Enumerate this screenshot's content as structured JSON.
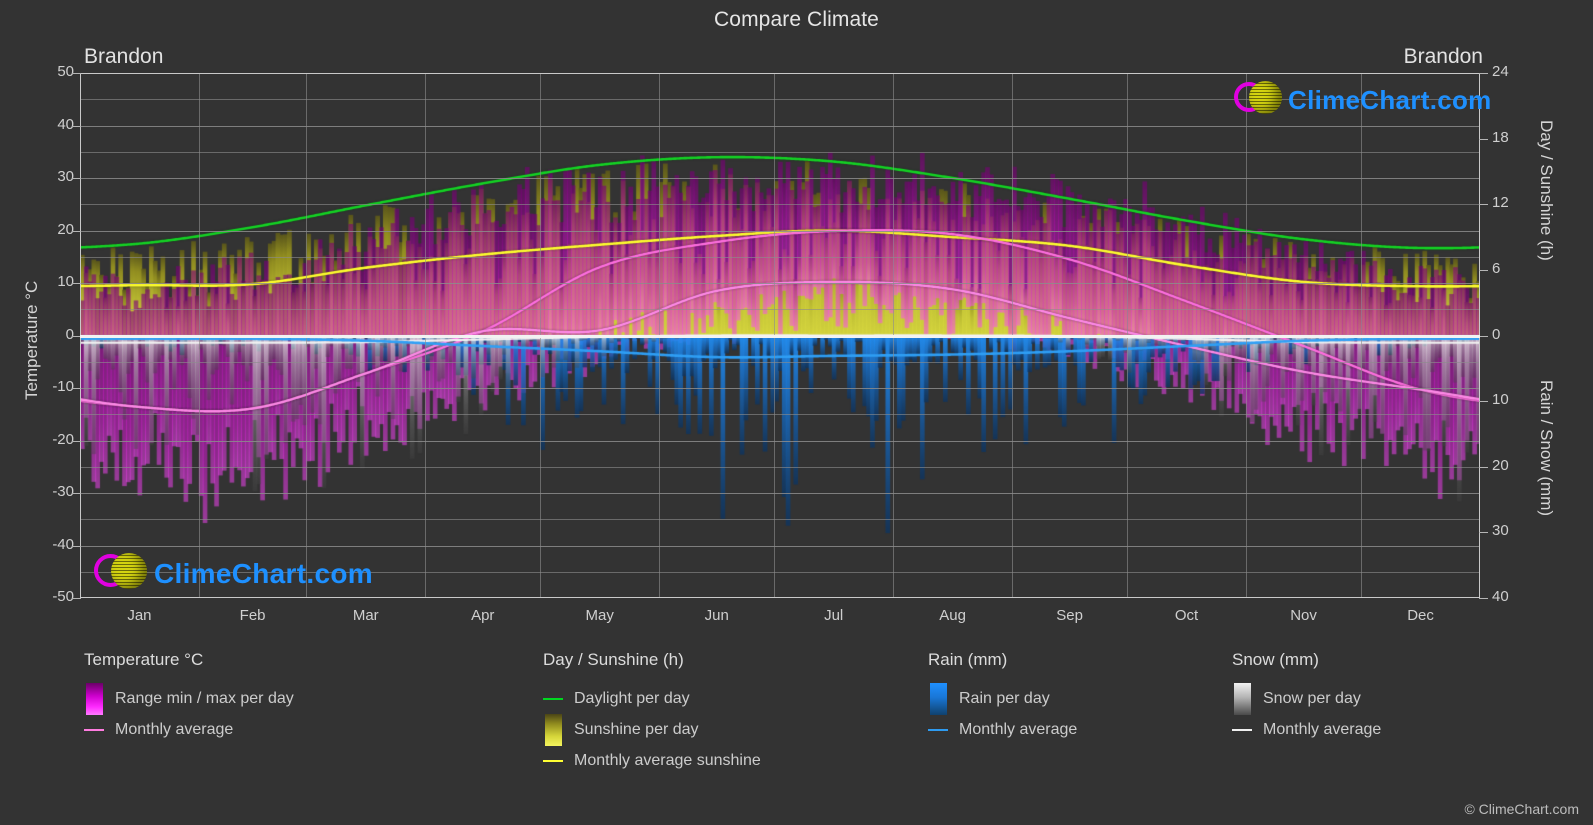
{
  "header": {
    "title": "Compare Climate",
    "city_left": "Brandon",
    "city_right": "Brandon"
  },
  "axes": {
    "left_title": "Temperature °C",
    "right_title_top": "Day / Sunshine (h)",
    "right_title_bottom": "Rain / Snow (mm)",
    "temp_ticks": [
      "50",
      "40",
      "30",
      "20",
      "10",
      "0",
      "-10",
      "-20",
      "-30",
      "-40",
      "-50"
    ],
    "day_ticks": [
      "24",
      "18",
      "12",
      "6",
      "0"
    ],
    "precip_ticks": [
      "0",
      "10",
      "20",
      "30",
      "40"
    ],
    "months": [
      "Jan",
      "Feb",
      "Mar",
      "Apr",
      "May",
      "Jun",
      "Jul",
      "Aug",
      "Sep",
      "Oct",
      "Nov",
      "Dec"
    ]
  },
  "legend": {
    "temperature": {
      "heading": "Temperature °C",
      "items": [
        {
          "label": "Range min / max per day",
          "marker": "gradient-box",
          "color": "#ff00ff"
        },
        {
          "label": "Monthly average",
          "marker": "line",
          "color": "#ff7ce0"
        }
      ]
    },
    "daysun": {
      "heading": "Day / Sunshine (h)",
      "items": [
        {
          "label": "Daylight per day",
          "marker": "line",
          "color": "#00d720"
        },
        {
          "label": "Sunshine per day",
          "marker": "gradient-box",
          "color": "#f2f24a"
        },
        {
          "label": "Monthly average sunshine",
          "marker": "line",
          "color": "#ffff33"
        }
      ]
    },
    "rain": {
      "heading": "Rain (mm)",
      "items": [
        {
          "label": "Rain per day",
          "marker": "gradient-box",
          "color": "#1e90ff"
        },
        {
          "label": "Monthly average",
          "marker": "line",
          "color": "#2e9bf0"
        }
      ]
    },
    "snow": {
      "heading": "Snow (mm)",
      "items": [
        {
          "label": "Snow per day",
          "marker": "gradient-box",
          "color": "#e8e8e8"
        },
        {
          "label": "Monthly average",
          "marker": "line",
          "color": "#f0f0f0"
        }
      ]
    }
  },
  "watermark": {
    "text": "ClimeChart.com",
    "copyright": "© ClimeChart.com",
    "text_color": "#1e90ff",
    "ring_color": "#e000e0",
    "ball_color": "#d4d411"
  },
  "chart_data": {
    "type": "line",
    "title": "Compare Climate",
    "subtitle": "Brandon",
    "xlabel": "",
    "ylabel": "Temperature °C",
    "y2label_top": "Day / Sunshine (h)",
    "y2label_bottom": "Rain / Snow (mm)",
    "categories": [
      "Jan",
      "Feb",
      "Mar",
      "Apr",
      "May",
      "Jun",
      "Jul",
      "Aug",
      "Sep",
      "Oct",
      "Nov",
      "Dec"
    ],
    "ylim": [
      -50,
      50
    ],
    "y2lim_day": [
      0,
      24
    ],
    "y2lim_precip": [
      0,
      40
    ],
    "grid": true,
    "legend_position": "bottom",
    "series": [
      {
        "name": "Monthly average temperature min",
        "color": "#ff7ce0",
        "unit": "°C",
        "values": [
          -13.6,
          -13.9,
          -7.2,
          0.8,
          1.0,
          8.5,
          10.2,
          8.8,
          3.3,
          -2.0,
          -6.9,
          -10.3
        ]
      },
      {
        "name": "Monthly average temperature max",
        "color": "#ff7ce0",
        "unit": "°C",
        "values": [
          -13.6,
          -13.9,
          -7.2,
          0.8,
          13.0,
          17.8,
          19.9,
          19.3,
          14.5,
          6.5,
          -2.0,
          -10.3
        ]
      },
      {
        "name": "Daylight per day",
        "color": "#00d720",
        "unit": "h",
        "values": [
          8.4,
          9.9,
          11.9,
          13.9,
          15.6,
          16.3,
          15.9,
          14.4,
          12.5,
          10.5,
          8.8,
          8.0
        ]
      },
      {
        "name": "Monthly average sunshine",
        "color": "#ffff33",
        "unit": "h",
        "values": [
          4.6,
          4.7,
          6.2,
          7.4,
          8.3,
          9.1,
          9.6,
          9.0,
          8.2,
          6.4,
          4.9,
          4.5
        ]
      },
      {
        "name": "Rain monthly average",
        "color": "#2e9bf0",
        "unit": "mm/day",
        "values": [
          0.5,
          0.5,
          0.8,
          1.6,
          2.4,
          3.3,
          3.1,
          2.9,
          2.4,
          1.6,
          0.8,
          0.5
        ]
      },
      {
        "name": "Snow monthly average",
        "color": "#f0f0f0",
        "unit": "mm/day",
        "values": [
          1.1,
          1.1,
          1.0,
          0.6,
          0.2,
          0.0,
          0.0,
          0.0,
          0.1,
          0.5,
          1.0,
          1.1
        ]
      }
    ],
    "bands": [
      {
        "name": "Temperature range min / max per day",
        "color": "#ff00ff",
        "unit": "°C",
        "min": [
          -30,
          -29,
          -22,
          -12,
          -3,
          3,
          6,
          4,
          -2,
          -10,
          -20,
          -27
        ],
        "max": [
          10,
          13,
          20,
          27,
          31,
          32,
          33,
          32,
          29,
          24,
          16,
          11
        ]
      },
      {
        "name": "Sunshine per day",
        "color": "#f2f24a",
        "unit": "h",
        "min": [
          0,
          0,
          0,
          0,
          0,
          0,
          0,
          0,
          0,
          0,
          0,
          0
        ],
        "max": [
          8.4,
          9.9,
          11.9,
          13.9,
          15.6,
          16.3,
          15.9,
          14.4,
          12.5,
          10.5,
          8.8,
          8.0
        ]
      },
      {
        "name": "Rain per day",
        "color": "#1e90ff",
        "unit": "mm",
        "min": [
          0,
          0,
          0,
          0,
          0,
          0,
          0,
          0,
          0,
          0,
          0,
          0
        ],
        "max": [
          3,
          3,
          6,
          12,
          22,
          30,
          30,
          28,
          24,
          14,
          6,
          3
        ]
      },
      {
        "name": "Snow per day",
        "color": "#cfcfcf",
        "unit": "mm",
        "min": [
          0,
          0,
          0,
          0,
          0,
          0,
          0,
          0,
          0,
          0,
          0,
          0
        ],
        "max": [
          26,
          24,
          22,
          14,
          4,
          0,
          0,
          0,
          2,
          10,
          20,
          25
        ]
      }
    ]
  }
}
